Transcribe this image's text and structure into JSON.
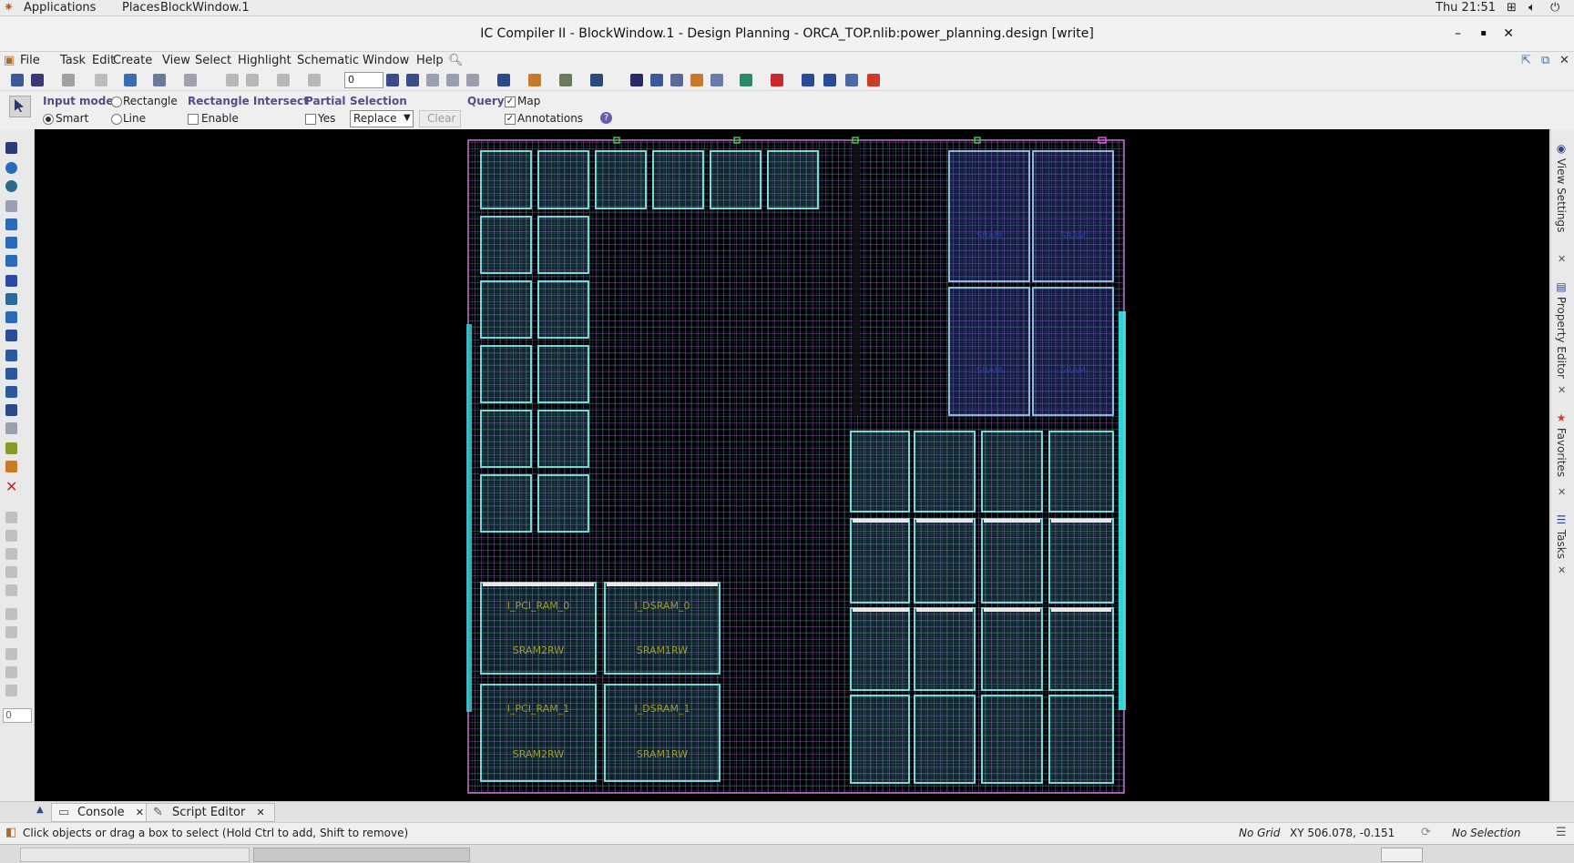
{
  "topbar": {
    "applications": "Applications",
    "places": "Places",
    "active_window": "BlockWindow.1",
    "clock": "Thu 21:51"
  },
  "window": {
    "title": "IC Compiler II - BlockWindow.1 - Design Planning - ORCA_TOP.nlib:power_planning.design [write]"
  },
  "menu": [
    "File",
    "Task",
    "Edit",
    "Create",
    "View",
    "Select",
    "Highlight",
    "Schematic",
    "Window",
    "Help"
  ],
  "toolbar": {
    "spin_value": "0"
  },
  "options": {
    "input_mode_label": "Input mode",
    "rectangle": "Rectangle",
    "smart": "Smart",
    "line": "Line",
    "rect_intersect_label": "Rectangle Intersect",
    "enable": "Enable",
    "partial_label": "Partial",
    "yes": "Yes",
    "selection_label": "Selection",
    "selection_value": "Replace",
    "clear": "Clear",
    "query_label": "Query",
    "map": "Map",
    "annotations": "Annotations"
  },
  "left_input_value": "0",
  "right_tabs": [
    "View Settings",
    "Property Editor",
    "Favorites",
    "Tasks"
  ],
  "canvas": {
    "sram_labels": {
      "a": "I_PCI_RAM_0",
      "b": "I_DSRAM_0",
      "c": "I_PCI_RAM_1",
      "d": "I_DSRAM_1",
      "ref_a": "SRAM2RW",
      "ref_b": "SRAM1RW",
      "ref_c": "SRAM2RW",
      "ref_d": "SRAM1RW"
    },
    "blue_label": "SRAM"
  },
  "bottom_tabs": [
    {
      "label": "Console"
    },
    {
      "label": "Script Editor"
    }
  ],
  "status": {
    "hint": "Click objects or drag a box to select (Hold Ctrl to add, Shift to remove)",
    "grid": "No Grid",
    "xy": "XY 506.078, -0.151",
    "selection": "No Selection"
  },
  "colors": {
    "canvas_bg": "#000000",
    "grid": "#c878c8",
    "grid2": "#6ec8e0",
    "macro": "#7ad8d0",
    "accent": "#5a4a8a"
  }
}
